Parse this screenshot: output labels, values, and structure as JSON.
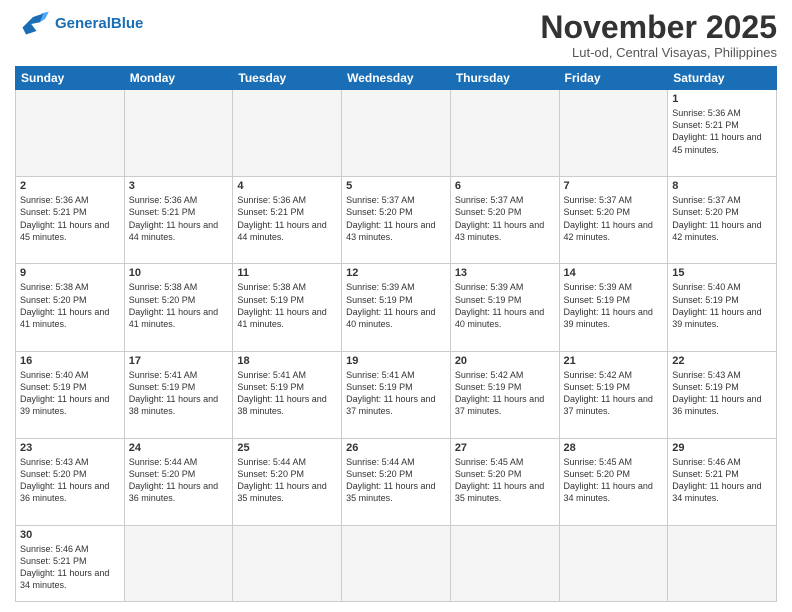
{
  "header": {
    "logo_general": "General",
    "logo_blue": "Blue",
    "month_title": "November 2025",
    "location": "Lut-od, Central Visayas, Philippines"
  },
  "days_of_week": [
    "Sunday",
    "Monday",
    "Tuesday",
    "Wednesday",
    "Thursday",
    "Friday",
    "Saturday"
  ],
  "weeks": [
    [
      {
        "day": "",
        "sunrise": "",
        "sunset": "",
        "daylight": "",
        "empty": true
      },
      {
        "day": "",
        "sunrise": "",
        "sunset": "",
        "daylight": "",
        "empty": true
      },
      {
        "day": "",
        "sunrise": "",
        "sunset": "",
        "daylight": "",
        "empty": true
      },
      {
        "day": "",
        "sunrise": "",
        "sunset": "",
        "daylight": "",
        "empty": true
      },
      {
        "day": "",
        "sunrise": "",
        "sunset": "",
        "daylight": "",
        "empty": true
      },
      {
        "day": "",
        "sunrise": "",
        "sunset": "",
        "daylight": "",
        "empty": true
      },
      {
        "day": "1",
        "sunrise": "Sunrise: 5:36 AM",
        "sunset": "Sunset: 5:21 PM",
        "daylight": "Daylight: 11 hours and 45 minutes.",
        "empty": false
      }
    ],
    [
      {
        "day": "2",
        "sunrise": "Sunrise: 5:36 AM",
        "sunset": "Sunset: 5:21 PM",
        "daylight": "Daylight: 11 hours and 45 minutes.",
        "empty": false
      },
      {
        "day": "3",
        "sunrise": "Sunrise: 5:36 AM",
        "sunset": "Sunset: 5:21 PM",
        "daylight": "Daylight: 11 hours and 44 minutes.",
        "empty": false
      },
      {
        "day": "4",
        "sunrise": "Sunrise: 5:36 AM",
        "sunset": "Sunset: 5:21 PM",
        "daylight": "Daylight: 11 hours and 44 minutes.",
        "empty": false
      },
      {
        "day": "5",
        "sunrise": "Sunrise: 5:37 AM",
        "sunset": "Sunset: 5:20 PM",
        "daylight": "Daylight: 11 hours and 43 minutes.",
        "empty": false
      },
      {
        "day": "6",
        "sunrise": "Sunrise: 5:37 AM",
        "sunset": "Sunset: 5:20 PM",
        "daylight": "Daylight: 11 hours and 43 minutes.",
        "empty": false
      },
      {
        "day": "7",
        "sunrise": "Sunrise: 5:37 AM",
        "sunset": "Sunset: 5:20 PM",
        "daylight": "Daylight: 11 hours and 42 minutes.",
        "empty": false
      },
      {
        "day": "8",
        "sunrise": "Sunrise: 5:37 AM",
        "sunset": "Sunset: 5:20 PM",
        "daylight": "Daylight: 11 hours and 42 minutes.",
        "empty": false
      }
    ],
    [
      {
        "day": "9",
        "sunrise": "Sunrise: 5:38 AM",
        "sunset": "Sunset: 5:20 PM",
        "daylight": "Daylight: 11 hours and 41 minutes.",
        "empty": false
      },
      {
        "day": "10",
        "sunrise": "Sunrise: 5:38 AM",
        "sunset": "Sunset: 5:20 PM",
        "daylight": "Daylight: 11 hours and 41 minutes.",
        "empty": false
      },
      {
        "day": "11",
        "sunrise": "Sunrise: 5:38 AM",
        "sunset": "Sunset: 5:19 PM",
        "daylight": "Daylight: 11 hours and 41 minutes.",
        "empty": false
      },
      {
        "day": "12",
        "sunrise": "Sunrise: 5:39 AM",
        "sunset": "Sunset: 5:19 PM",
        "daylight": "Daylight: 11 hours and 40 minutes.",
        "empty": false
      },
      {
        "day": "13",
        "sunrise": "Sunrise: 5:39 AM",
        "sunset": "Sunset: 5:19 PM",
        "daylight": "Daylight: 11 hours and 40 minutes.",
        "empty": false
      },
      {
        "day": "14",
        "sunrise": "Sunrise: 5:39 AM",
        "sunset": "Sunset: 5:19 PM",
        "daylight": "Daylight: 11 hours and 39 minutes.",
        "empty": false
      },
      {
        "day": "15",
        "sunrise": "Sunrise: 5:40 AM",
        "sunset": "Sunset: 5:19 PM",
        "daylight": "Daylight: 11 hours and 39 minutes.",
        "empty": false
      }
    ],
    [
      {
        "day": "16",
        "sunrise": "Sunrise: 5:40 AM",
        "sunset": "Sunset: 5:19 PM",
        "daylight": "Daylight: 11 hours and 39 minutes.",
        "empty": false
      },
      {
        "day": "17",
        "sunrise": "Sunrise: 5:41 AM",
        "sunset": "Sunset: 5:19 PM",
        "daylight": "Daylight: 11 hours and 38 minutes.",
        "empty": false
      },
      {
        "day": "18",
        "sunrise": "Sunrise: 5:41 AM",
        "sunset": "Sunset: 5:19 PM",
        "daylight": "Daylight: 11 hours and 38 minutes.",
        "empty": false
      },
      {
        "day": "19",
        "sunrise": "Sunrise: 5:41 AM",
        "sunset": "Sunset: 5:19 PM",
        "daylight": "Daylight: 11 hours and 37 minutes.",
        "empty": false
      },
      {
        "day": "20",
        "sunrise": "Sunrise: 5:42 AM",
        "sunset": "Sunset: 5:19 PM",
        "daylight": "Daylight: 11 hours and 37 minutes.",
        "empty": false
      },
      {
        "day": "21",
        "sunrise": "Sunrise: 5:42 AM",
        "sunset": "Sunset: 5:19 PM",
        "daylight": "Daylight: 11 hours and 37 minutes.",
        "empty": false
      },
      {
        "day": "22",
        "sunrise": "Sunrise: 5:43 AM",
        "sunset": "Sunset: 5:19 PM",
        "daylight": "Daylight: 11 hours and 36 minutes.",
        "empty": false
      }
    ],
    [
      {
        "day": "23",
        "sunrise": "Sunrise: 5:43 AM",
        "sunset": "Sunset: 5:20 PM",
        "daylight": "Daylight: 11 hours and 36 minutes.",
        "empty": false
      },
      {
        "day": "24",
        "sunrise": "Sunrise: 5:44 AM",
        "sunset": "Sunset: 5:20 PM",
        "daylight": "Daylight: 11 hours and 36 minutes.",
        "empty": false
      },
      {
        "day": "25",
        "sunrise": "Sunrise: 5:44 AM",
        "sunset": "Sunset: 5:20 PM",
        "daylight": "Daylight: 11 hours and 35 minutes.",
        "empty": false
      },
      {
        "day": "26",
        "sunrise": "Sunrise: 5:44 AM",
        "sunset": "Sunset: 5:20 PM",
        "daylight": "Daylight: 11 hours and 35 minutes.",
        "empty": false
      },
      {
        "day": "27",
        "sunrise": "Sunrise: 5:45 AM",
        "sunset": "Sunset: 5:20 PM",
        "daylight": "Daylight: 11 hours and 35 minutes.",
        "empty": false
      },
      {
        "day": "28",
        "sunrise": "Sunrise: 5:45 AM",
        "sunset": "Sunset: 5:20 PM",
        "daylight": "Daylight: 11 hours and 34 minutes.",
        "empty": false
      },
      {
        "day": "29",
        "sunrise": "Sunrise: 5:46 AM",
        "sunset": "Sunset: 5:21 PM",
        "daylight": "Daylight: 11 hours and 34 minutes.",
        "empty": false
      }
    ],
    [
      {
        "day": "30",
        "sunrise": "Sunrise: 5:46 AM",
        "sunset": "Sunset: 5:21 PM",
        "daylight": "Daylight: 11 hours and 34 minutes.",
        "empty": false
      },
      {
        "day": "",
        "empty": true
      },
      {
        "day": "",
        "empty": true
      },
      {
        "day": "",
        "empty": true
      },
      {
        "day": "",
        "empty": true
      },
      {
        "day": "",
        "empty": true
      },
      {
        "day": "",
        "empty": true
      }
    ]
  ]
}
